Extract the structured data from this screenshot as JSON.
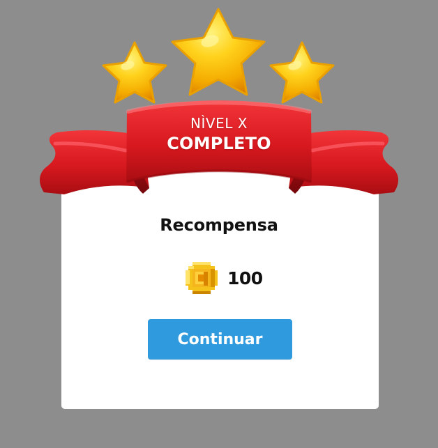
{
  "level_banner": {
    "line1": "NÌVEL X",
    "line2": "COMPLETO"
  },
  "reward": {
    "title": "Recompensa",
    "coin_icon": "pixel-gold-coin",
    "amount": "100"
  },
  "actions": {
    "continue_label": "Continuar"
  },
  "stars": {
    "count": 3,
    "earned": 3
  },
  "colors": {
    "background": "#8d8d8d",
    "card": "#ffffff",
    "ribbon": "#d7191f",
    "star": "#f6c11b",
    "button": "#2f9bde",
    "text": "#111111"
  }
}
